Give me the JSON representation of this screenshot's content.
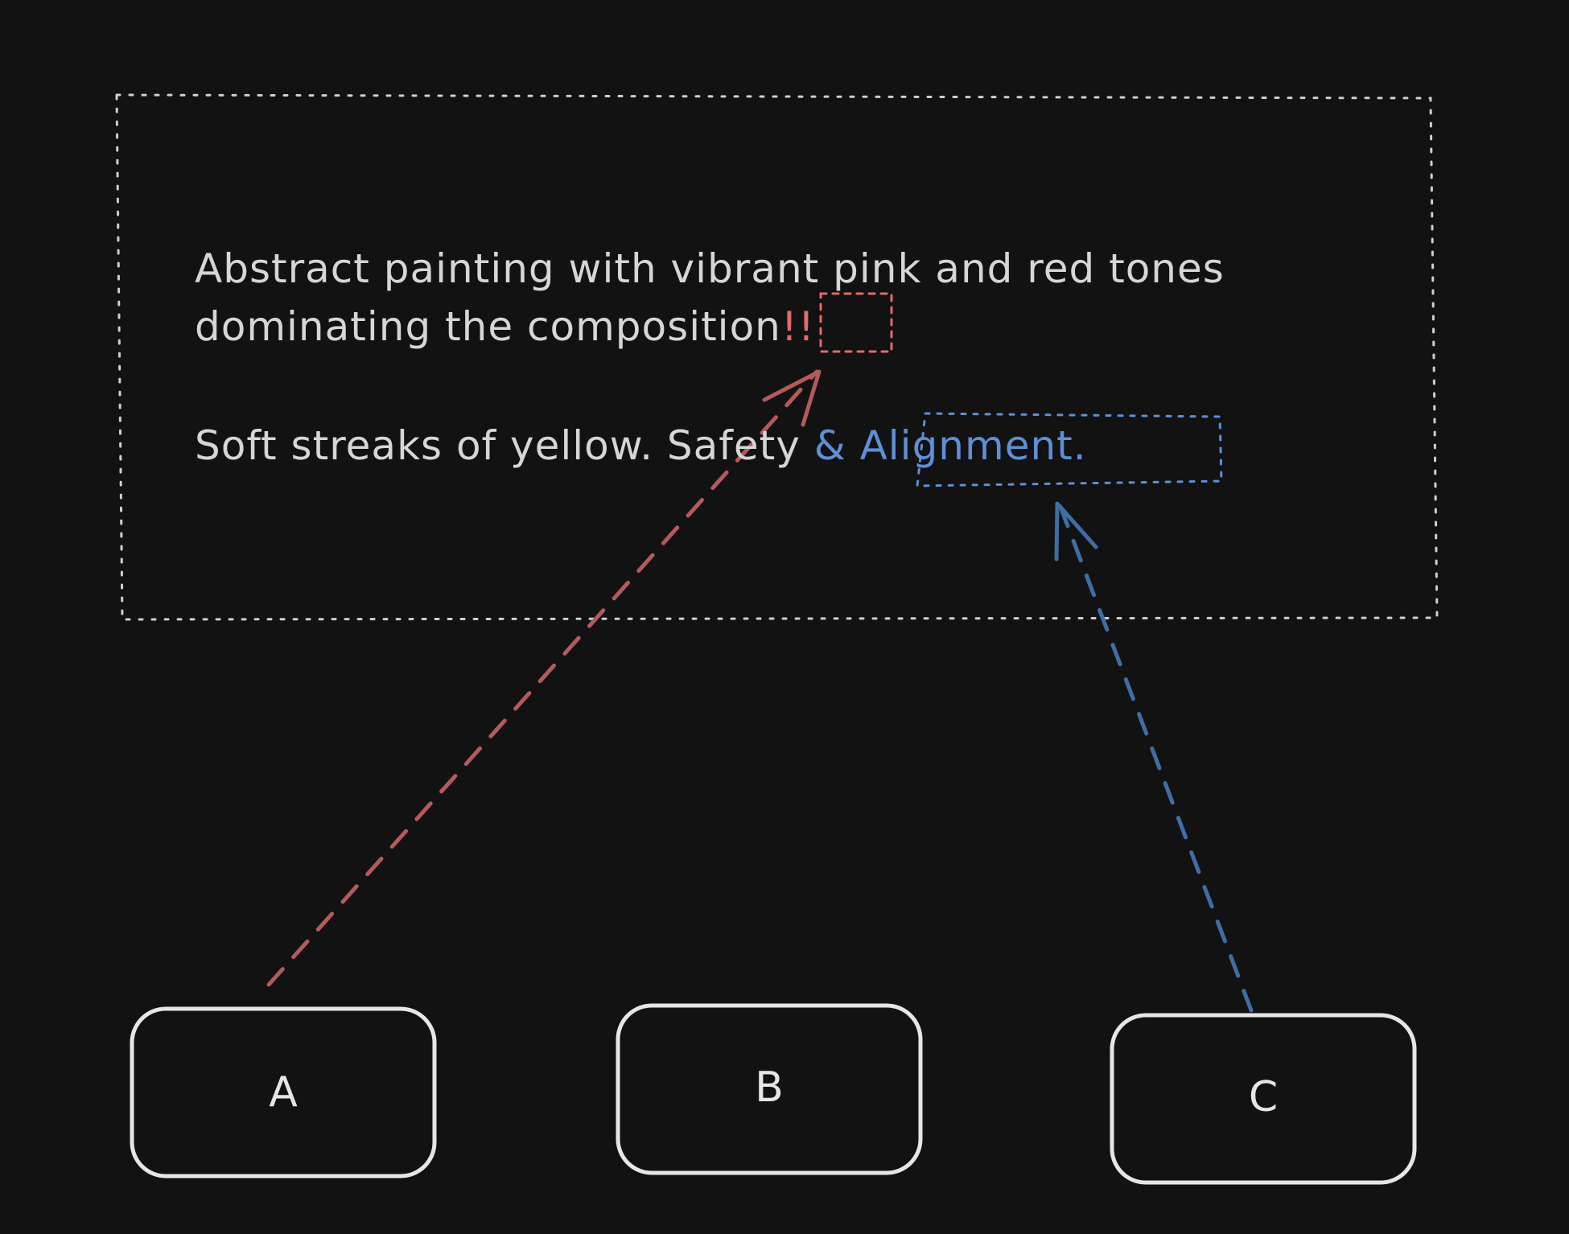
{
  "diagram": {
    "text": {
      "line1": "Abstract painting with vibrant pink and red tones",
      "line2_prefix": "dominating the composition",
      "line2_highlight": "!!",
      "line3_prefix": "Soft streaks of yellow. Safety ",
      "line3_highlight": "& Alignment."
    },
    "nodes": [
      {
        "id": "A",
        "label": "A"
      },
      {
        "id": "B",
        "label": "B"
      },
      {
        "id": "C",
        "label": "C"
      }
    ],
    "edges": [
      {
        "from": "A",
        "to": "!!",
        "style": "dashed",
        "color": "#b35a5a"
      },
      {
        "from": "C",
        "to": "& Alignment.",
        "style": "dashed",
        "color": "#3f6ea6"
      }
    ],
    "colors": {
      "background": "#121212",
      "text": "#d6d6d6",
      "red_accent": "#e36a6a",
      "blue_accent": "#5f8fd6",
      "node_stroke": "#e6e6e6",
      "frame_stroke": "#d0d0d0"
    }
  }
}
